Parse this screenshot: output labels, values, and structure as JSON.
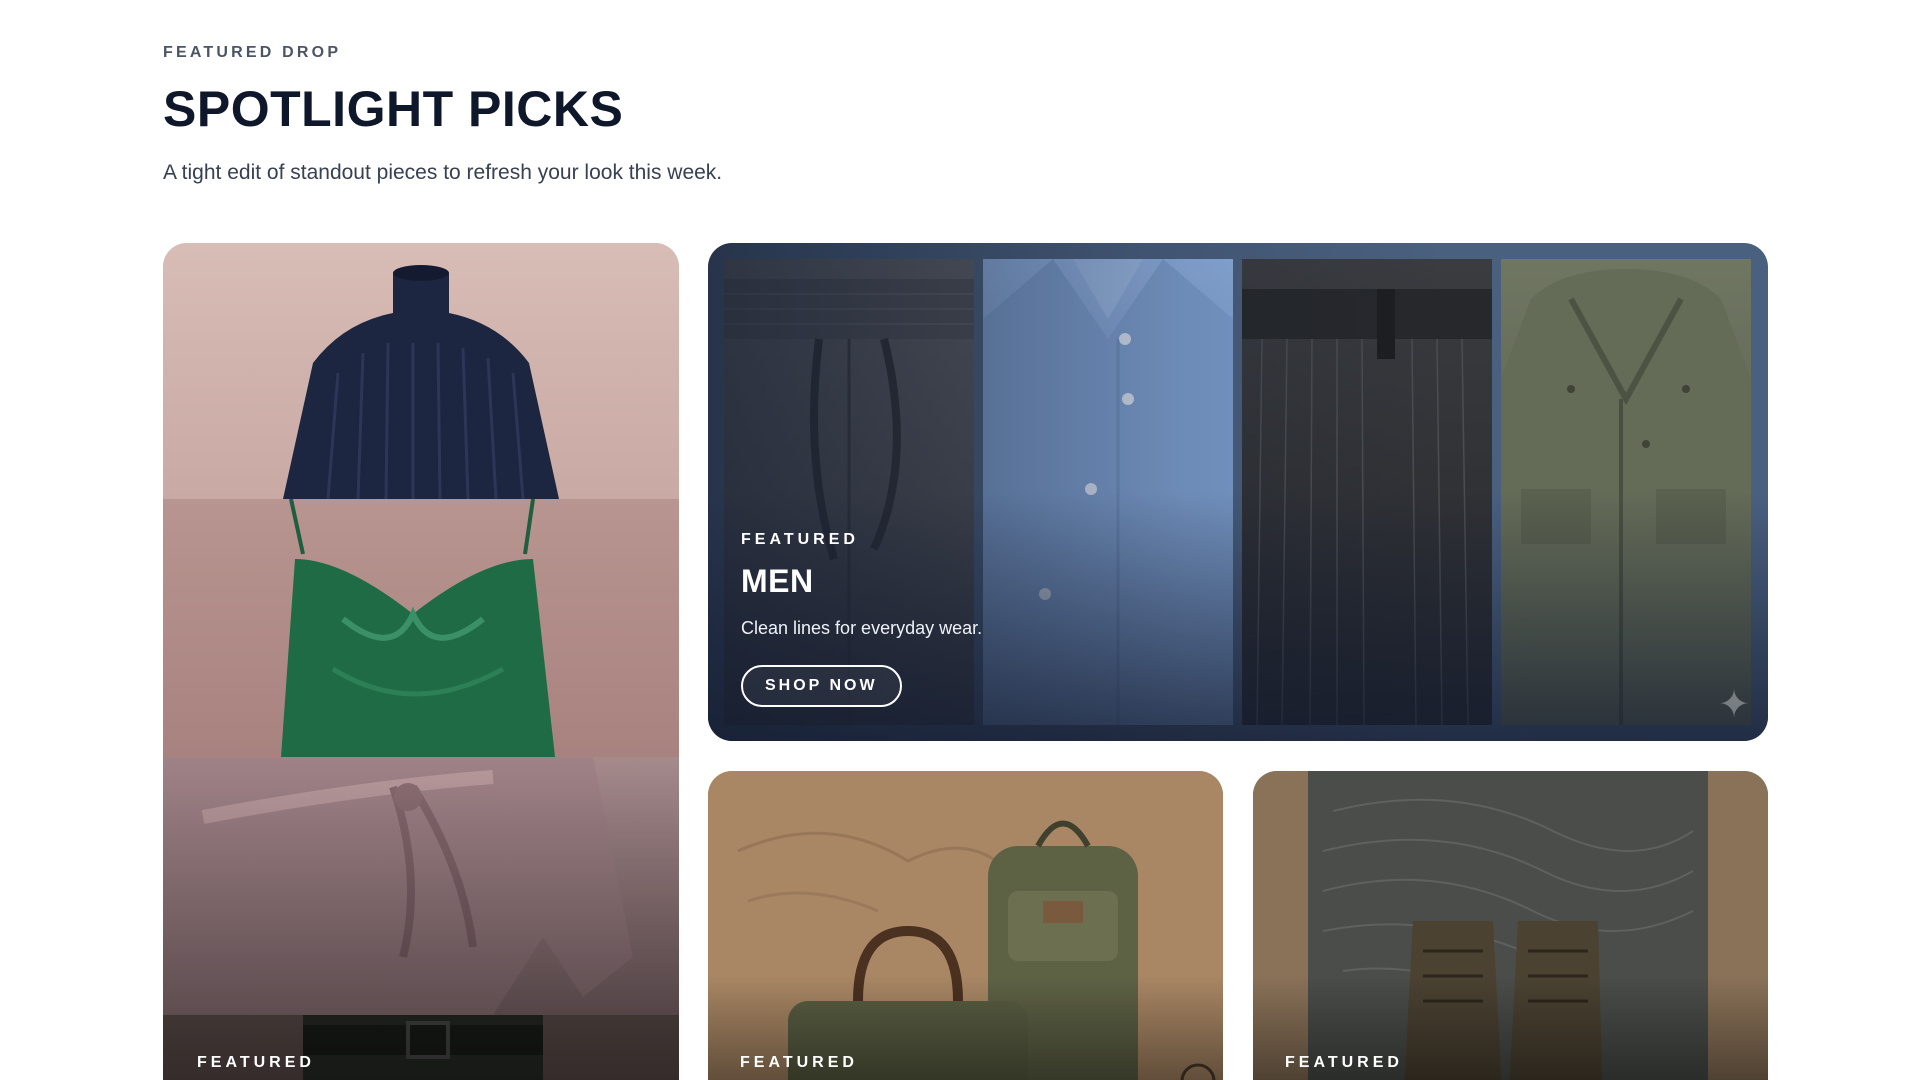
{
  "header": {
    "eyebrow": "FEATURED DROP",
    "title": "SPOTLIGHT PICKS",
    "subtitle": "A tight edit of standout pieces to refresh your look this week."
  },
  "cards": {
    "left": {
      "kicker": "FEATURED"
    },
    "men": {
      "kicker": "FEATURED",
      "title": "MEN",
      "description": "Clean lines for everyday wear.",
      "cta": "SHOP NOW"
    },
    "bags": {
      "kicker": "FEATURED"
    },
    "boots": {
      "kicker": "FEATURED"
    }
  },
  "colors": {
    "title": "#0f172a",
    "men_card_bg": "#4a607f",
    "left_card_bg": "#c9aaa7"
  },
  "icons": [
    "turtleneck-sweater",
    "satin-camisole",
    "wrap-dress",
    "belted-trousers",
    "drawstring-pants",
    "button-shirt",
    "pinstripe-trousers",
    "field-jacket",
    "sparkle-icon",
    "duffel-bag",
    "backpack",
    "hiking-boots"
  ]
}
